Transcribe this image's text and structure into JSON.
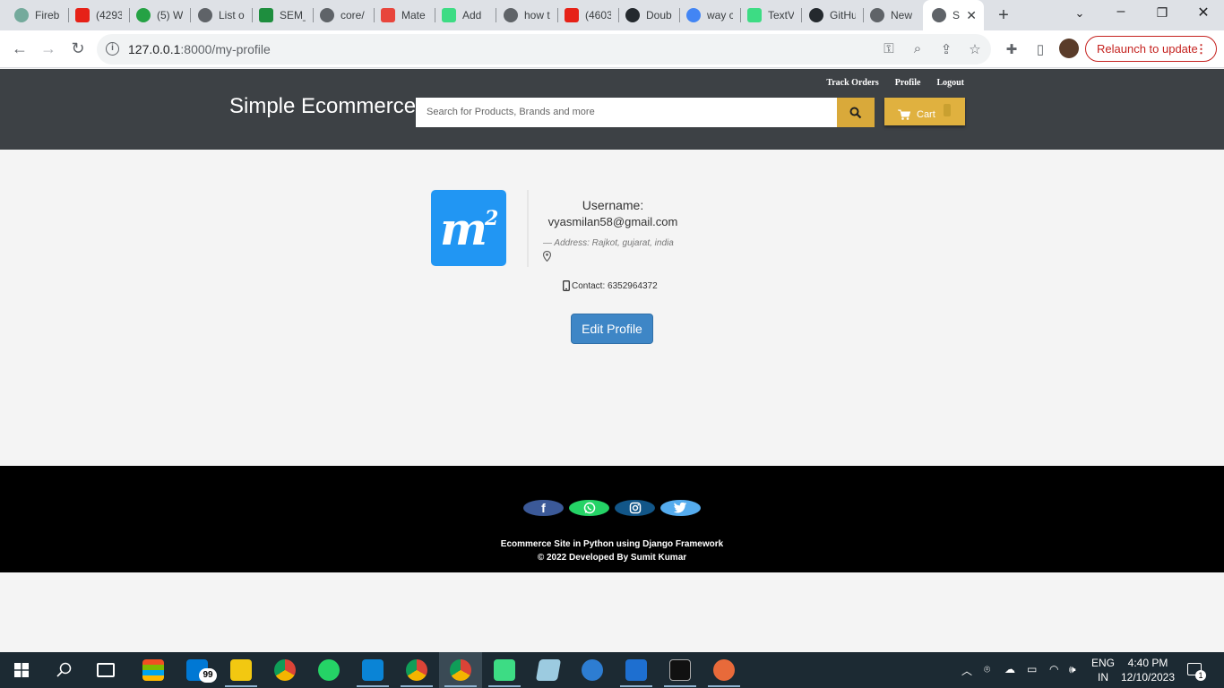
{
  "browser": {
    "tabs": [
      {
        "label": "Fireb",
        "icon": "openai-icon",
        "color": "#74aa9c"
      },
      {
        "label": "(4293",
        "icon": "youtube-icon",
        "color": "#e62117"
      },
      {
        "label": "(5) W",
        "icon": "whatsapp-icon",
        "color": "#25a244"
      },
      {
        "label": "List o",
        "icon": "globe-icon",
        "color": "#5f6368"
      },
      {
        "label": "SEM_",
        "icon": "sheets-icon",
        "color": "#1e8e3e"
      },
      {
        "label": "core/",
        "icon": "globe-icon",
        "color": "#5f6368"
      },
      {
        "label": "Mate",
        "icon": "material-icon",
        "color": "#e8453c"
      },
      {
        "label": "Add ",
        "icon": "android-icon",
        "color": "#3ddc84"
      },
      {
        "label": "how t",
        "icon": "globe-icon",
        "color": "#5f6368"
      },
      {
        "label": "(4603",
        "icon": "youtube-icon",
        "color": "#e62117"
      },
      {
        "label": "Doub",
        "icon": "github-icon",
        "color": "#24292e"
      },
      {
        "label": "way c",
        "icon": "google-icon",
        "color": "#4285f4"
      },
      {
        "label": "TextV",
        "icon": "android-icon",
        "color": "#3ddc84"
      },
      {
        "label": "GitHu",
        "icon": "github-icon",
        "color": "#24292e"
      },
      {
        "label": "New",
        "icon": "chrome-icon",
        "color": "#5f6368"
      }
    ],
    "active_tab": {
      "label": "S",
      "icon": "globe-icon"
    },
    "url_host": "127.0.0.1",
    "url_path": ":8000/my-profile",
    "relaunch_label": "Relaunch to update"
  },
  "site": {
    "nav_links": [
      "Track Orders",
      "Profile",
      "Logout"
    ],
    "brand": "Simple Ecommerce",
    "search_placeholder": "Search for Products, Brands and more",
    "cart_label": "Cart"
  },
  "profile": {
    "username_label": "Username:",
    "username_value": "vyasmilan58@gmail.com",
    "address_text": "— Address: Rajkot, gujarat, india",
    "contact_text": "Contact: 6352964372",
    "edit_button": "Edit Profile",
    "image_icon": "m2-logo-icon",
    "image_color": "#2196f3"
  },
  "footer": {
    "social": [
      {
        "name": "facebook",
        "color": "#3b5998"
      },
      {
        "name": "whatsapp",
        "color": "#25d366"
      },
      {
        "name": "instagram",
        "color": "#125688"
      },
      {
        "name": "twitter",
        "color": "#55acee"
      }
    ],
    "line1": "Ecommerce Site in Python using Django Framework",
    "line2": "© 2022 Developed By Sumit Kumar"
  },
  "taskbar": {
    "mail_badge": "99",
    "lang_top": "ENG",
    "lang_bottom": "IN",
    "time": "4:40 PM",
    "date": "12/10/2023",
    "notification_count": "1"
  }
}
